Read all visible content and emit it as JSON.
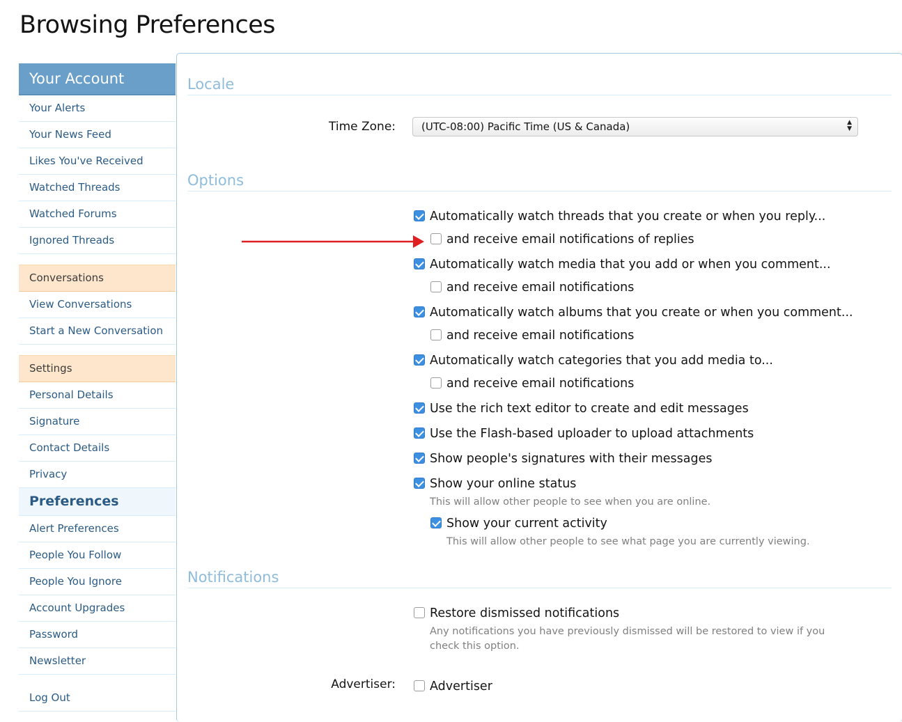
{
  "page": {
    "title": "Browsing Preferences"
  },
  "sidebar": {
    "header": "Your Account",
    "account_items": [
      "Your Alerts",
      "Your News Feed",
      "Likes You've Received",
      "Watched Threads",
      "Watched Forums",
      "Ignored Threads"
    ],
    "conversations": {
      "label": "Conversations",
      "items": [
        "View Conversations",
        "Start a New Conversation"
      ]
    },
    "settings": {
      "label": "Settings",
      "items": [
        "Personal Details",
        "Signature",
        "Contact Details",
        "Privacy"
      ],
      "active": "Preferences",
      "items_after": [
        "Alert Preferences",
        "People You Follow",
        "People You Ignore",
        "Account Upgrades",
        "Password",
        "Newsletter"
      ]
    },
    "logout": "Log Out"
  },
  "locale": {
    "heading": "Locale",
    "timezone_label": "Time Zone:",
    "timezone_value": "(UTC-08:00) Pacific Time (US & Canada)"
  },
  "options": {
    "heading": "Options",
    "items": [
      {
        "label": "Automatically watch threads that you create or when you reply...",
        "checked": true
      },
      {
        "label": "and receive email notifications of replies",
        "checked": false
      },
      {
        "label": "Automatically watch media that you add or when you comment...",
        "checked": true
      },
      {
        "label": "and receive email notifications",
        "checked": false
      },
      {
        "label": "Automatically watch albums that you create or when you comment...",
        "checked": true
      },
      {
        "label": "and receive email notifications",
        "checked": false
      },
      {
        "label": "Automatically watch categories that you add media to...",
        "checked": true
      },
      {
        "label": "and receive email notifications",
        "checked": false
      },
      {
        "label": "Use the rich text editor to create and edit messages",
        "checked": true
      },
      {
        "label": "Use the Flash-based uploader to upload attachments",
        "checked": true
      },
      {
        "label": "Show people's signatures with their messages",
        "checked": true
      },
      {
        "label": "Show your online status",
        "checked": true
      },
      {
        "label": "Show your current activity",
        "checked": true
      }
    ],
    "online_hint": "This will allow other people to see when you are online.",
    "activity_hint": "This will allow other people to see what page you are currently viewing."
  },
  "notifications": {
    "heading": "Notifications",
    "restore_label": "Restore dismissed notifications",
    "restore_checked": false,
    "restore_hint_1": "Any notifications you have previously dismissed will be restored to view if you",
    "restore_hint_2": "check this option.",
    "advertiser_field_label": "Advertiser:",
    "advertiser_label": "Advertiser",
    "advertiser_checked": false
  },
  "colors": {
    "sidebar_header": "#6a9fc9",
    "section_bg": "#fde6cb",
    "link": "#2b5b85",
    "section_heading": "#8fbcdb",
    "checkbox_on": "#3d8fe0",
    "annotation_arrow": "#e02020"
  }
}
